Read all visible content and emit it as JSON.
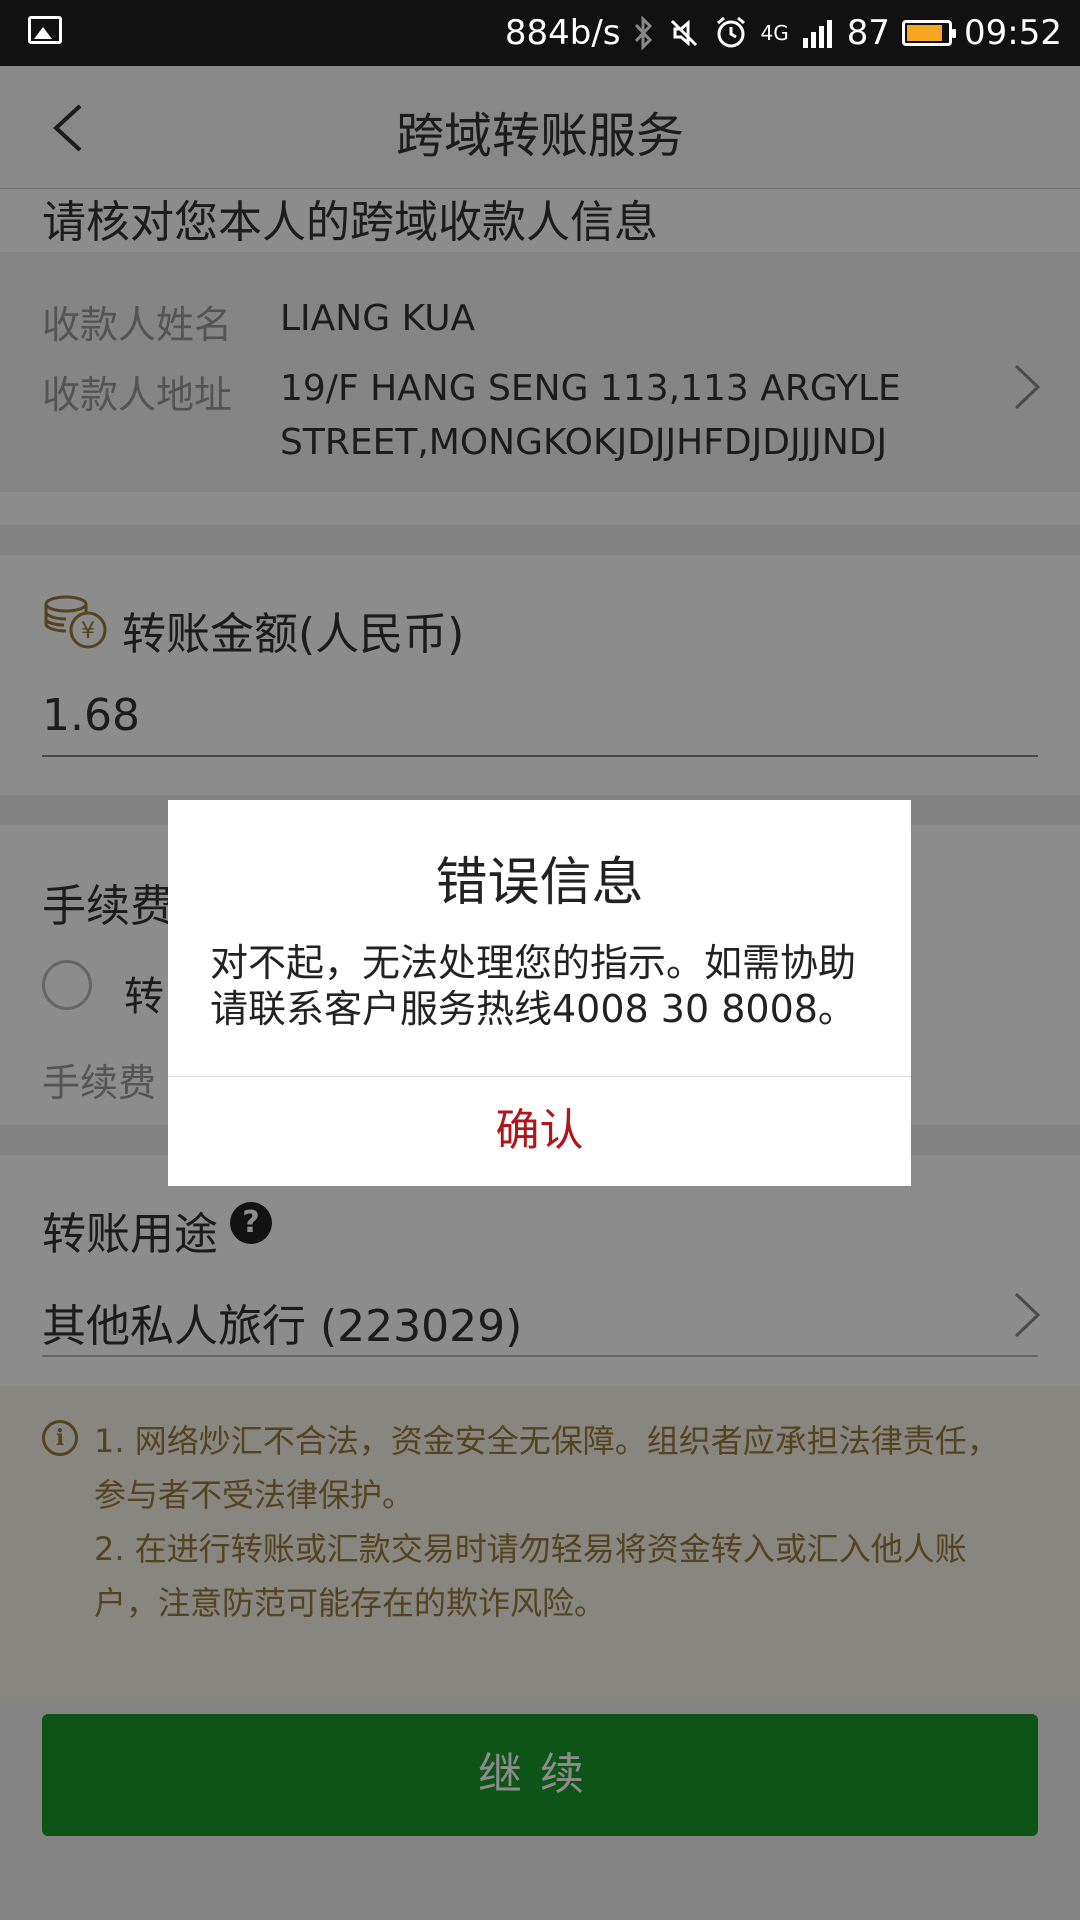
{
  "status_bar": {
    "net_speed": "884b/s",
    "network": "4G",
    "battery": "87",
    "time": "09:52",
    "icons": [
      "image-icon",
      "bluetooth-icon",
      "mute-icon",
      "alarm-icon",
      "signal-icon",
      "battery-icon"
    ],
    "battery_level": 0.87,
    "battery_color": "#f5a623"
  },
  "header": {
    "title": "跨域转账服务",
    "back_icon": "back-icon"
  },
  "payee": {
    "heading": "请核对您本人的跨域收款人信息",
    "name_label": "收款人姓名",
    "name_value": "LIANG KUA",
    "address_label": "收款人地址",
    "address_line1": "19/F HANG SENG 113,113 ARGYLE",
    "address_line2": "STREET,MONGKOKJDJJHFDJDJJJNDJ"
  },
  "amount": {
    "label": "转账金额(人民币)",
    "value": "1.68",
    "icon": "coins-icon"
  },
  "fee": {
    "heading": "手续费",
    "option": "转",
    "note": "手续费"
  },
  "purpose": {
    "heading": "转账用途",
    "help": "?",
    "value": "其他私人旅行 (223029)"
  },
  "notice": {
    "line1": "1. 网络炒汇不合法，资金安全无保障。组织者应承担法律责任，",
    "line2": "参与者不受法律保护。",
    "line3": "2. 在进行转账或汇款交易时请勿轻易将资金转入或汇入他人账",
    "line4": "户，注意防范可能存在的欺诈风险。"
  },
  "continue_label": "继续",
  "dialog": {
    "title": "错误信息",
    "message_line1": "对不起，无法处理您的指示。如需协助",
    "message_line2": "请联系客户服务热线4008 30 8008。",
    "confirm": "确认"
  },
  "colors": {
    "primary_green": "#1a9a2a",
    "confirm_red": "#b0151a",
    "notice_text": "#9a7a3a"
  }
}
